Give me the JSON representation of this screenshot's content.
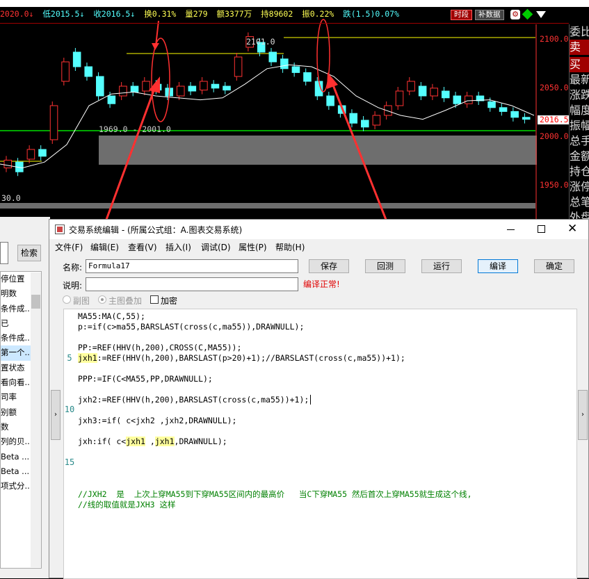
{
  "chart": {
    "topbar": {
      "prev_close_tail": "2020.0↓",
      "low": "低2015.5↓",
      "close": "收2016.5↓",
      "turnover_rate": "换0.31%",
      "volume": "量279",
      "amount": "额3377万",
      "open_interest": "持89602",
      "amplitude": "振0.22%",
      "change": "跌(1.5)0.07%"
    },
    "buttons": {
      "timeshare": "时段",
      "fill_data": "补数据"
    },
    "price_labels": [
      "2100.0",
      "2050.0",
      "2000.0",
      "1950.0"
    ],
    "current_price": "2016.5",
    "annotations": {
      "high": "2101.0",
      "range": "1969.0 - 2001.0",
      "bottom": "30.0"
    },
    "right_panel": [
      "委比",
      "卖",
      "买",
      "最新",
      "涨跌",
      "幅度",
      "振幅",
      "总手",
      "金额",
      "持仓",
      "涨停",
      "总笔",
      "外盘"
    ],
    "colors": {
      "up": "#ff3232",
      "down": "#54ffff",
      "ma": "#ffffff",
      "high_line": "#ffff00",
      "support": "#00e000",
      "arrow": "#ff3030"
    },
    "ma_series": [
      1970,
      1966,
      1972,
      1990,
      2030,
      2042,
      2044,
      2040,
      2038,
      2036,
      2038,
      2052,
      2068,
      2072,
      2070,
      2060,
      2040,
      2028,
      2020,
      2016,
      2025,
      2035,
      2036,
      2030,
      2020
    ],
    "candles": [
      [
        1966,
        1974
      ],
      [
        1972,
        1962
      ],
      [
        1975,
        1985
      ],
      [
        1985,
        1978
      ],
      [
        1995,
        2030
      ],
      [
        2055,
        2075
      ],
      [
        2085,
        2070
      ],
      [
        2070,
        2060
      ],
      [
        2060,
        2040
      ],
      [
        2040,
        2032
      ],
      [
        2040,
        2050
      ],
      [
        2050,
        2044
      ],
      [
        2045,
        2055
      ],
      [
        2052,
        2046
      ],
      [
        2048,
        2040
      ],
      [
        2040,
        2050
      ],
      [
        2050,
        2045
      ],
      [
        2046,
        2055
      ],
      [
        2052,
        2048
      ],
      [
        2050,
        2046
      ],
      [
        2060,
        2080
      ],
      [
        2090,
        2101
      ],
      [
        2095,
        2085
      ],
      [
        2085,
        2075
      ],
      [
        2078,
        2068
      ],
      [
        2070,
        2064
      ],
      [
        2064,
        2055
      ],
      [
        2055,
        2040
      ],
      [
        2040,
        2030
      ],
      [
        2030,
        2022
      ],
      [
        2022,
        2012
      ],
      [
        2015,
        2008
      ],
      [
        2010,
        2020
      ],
      [
        2020,
        2030
      ],
      [
        2030,
        2045
      ],
      [
        2045,
        2055
      ],
      [
        2050,
        2040
      ],
      [
        2040,
        2048
      ],
      [
        2045,
        2038
      ],
      [
        2040,
        2032
      ],
      [
        2032,
        2040
      ],
      [
        2040,
        2035
      ],
      [
        2034,
        2028
      ],
      [
        2028,
        2024
      ],
      [
        2024,
        2018
      ],
      [
        2018,
        2016
      ]
    ]
  },
  "left_panel": {
    "search_button": "检索",
    "items": [
      "停位置",
      "明数",
      "条件成...",
      "已",
      "条件成...",
      "第一个...",
      "置状态",
      "看向看...",
      "司率",
      "别额",
      "数",
      "列的贝...",
      "Beta ...",
      "Beta ...",
      "项式分..."
    ]
  },
  "dialog": {
    "title": "交易系统编辑 - (所属公式组：A.图表交易系统)",
    "menu": [
      "文件(F)",
      "编辑(E)",
      "查看(V)",
      "插入(I)",
      "调试(D)",
      "属性(P)",
      "帮助(H)"
    ],
    "name_label": "名称:",
    "name_value": "Formula17",
    "desc_label": "说明:",
    "desc_value": "",
    "buttons": [
      "保存",
      "回测",
      "运行",
      "编译",
      "确定"
    ],
    "compile_status": "编译正常!",
    "options": {
      "sub_chart": "副图",
      "main_overlay": "主图叠加",
      "encrypt": "加密"
    },
    "line_numbers": [
      "5",
      "10",
      "15"
    ],
    "code": {
      "l1": "MA55:MA(C,55);",
      "l2": "p:=if(c>ma55,BARSLAST(cross(c,ma55)),DRAWNULL);",
      "l4": "PP:=REF(HHV(h,200),CROSS(C,MA55));",
      "l5a": "jxh1",
      "l5b": ":=REF(HHV(h,200),BARSLAST(p>20)+1);//BARSLAST(cross(c,ma55))+1);",
      "l7": "PPP:=IF(C<MA55,PP,DRAWNULL);",
      "l9": "jxh2:=REF(HHV(h,200),BARSLAST(cross(c,ma55))+1);",
      "l11": "jxh3:=if( c<jxh2 ,jxh2,DRAWNULL);",
      "l13a": "jxh:if( c<",
      "l13b": "jxh1",
      "l13c": " ,",
      "l13d": "jxh1",
      "l13e": ",DRAWNULL);",
      "c1": "//JXH2  是  上次上穿MA55到下穿MA55区间内的最高价   当C下穿MA55 然后首次上穿MA55就生成这个线,",
      "c2": "//线的取值就是JXH3 这样"
    }
  }
}
